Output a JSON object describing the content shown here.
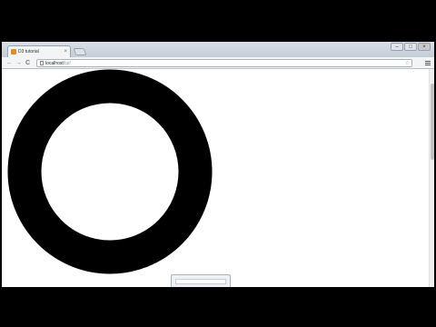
{
  "browser": {
    "tab_title": "D3 tutorial",
    "tab_close": "×",
    "url_host": "localhost",
    "url_path": "/tut/",
    "nav": {
      "back": "←",
      "forward": "→",
      "reload": "C"
    },
    "controls": {
      "minimize": "–",
      "maximize": "□",
      "close": "×"
    },
    "star": "☆"
  },
  "colors": {
    "ring": "#000000",
    "page_background": "#ffffff",
    "favicon": "#e58a2b"
  }
}
